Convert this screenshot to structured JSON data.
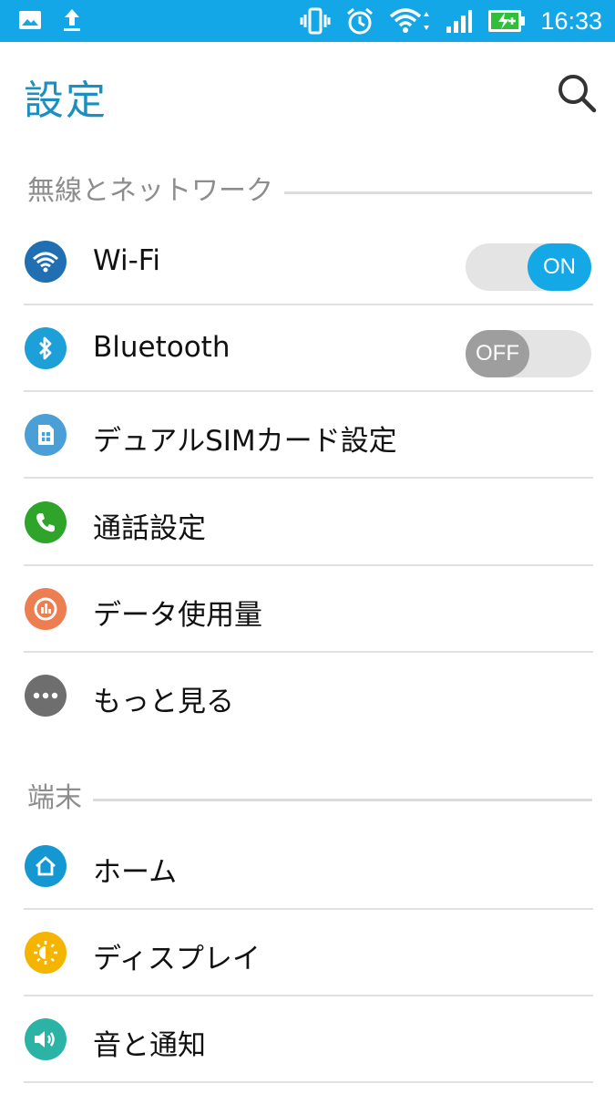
{
  "status_bar": {
    "time": "16:33",
    "icons": [
      "image-icon",
      "upload-icon",
      "vibrate-icon",
      "alarm-icon",
      "wifi-icon",
      "signal-icon",
      "battery-charging-icon"
    ]
  },
  "header": {
    "title": "設定",
    "search_icon": "search-icon"
  },
  "sections": [
    {
      "label": "無線とネットワーク",
      "items": [
        {
          "label": "Wi-Fi",
          "icon": "wifi-icon",
          "color": "#1f6fb2",
          "toggle": "ON"
        },
        {
          "label": "Bluetooth",
          "icon": "bluetooth-icon",
          "color": "#1d9fd8",
          "toggle": "OFF"
        },
        {
          "label": "デュアルSIMカード設定",
          "icon": "sim-card-icon",
          "color": "#4a9fd6"
        },
        {
          "label": "通話設定",
          "icon": "phone-icon",
          "color": "#2ea52a"
        },
        {
          "label": "データ使用量",
          "icon": "data-usage-icon",
          "color": "#ec7e52"
        },
        {
          "label": "もっと見る",
          "icon": "more-icon",
          "color": "#6e6e6e"
        }
      ]
    },
    {
      "label": "端末",
      "items": [
        {
          "label": "ホーム",
          "icon": "home-icon",
          "color": "#1597d2"
        },
        {
          "label": "ディスプレイ",
          "icon": "display-icon",
          "color": "#f5b400"
        },
        {
          "label": "音と通知",
          "icon": "sound-icon",
          "color": "#2bb3a5"
        }
      ]
    }
  ],
  "colors": {
    "accent": "#13a7e8",
    "title": "#1a8fc0",
    "section_label": "#8d8d8d"
  }
}
